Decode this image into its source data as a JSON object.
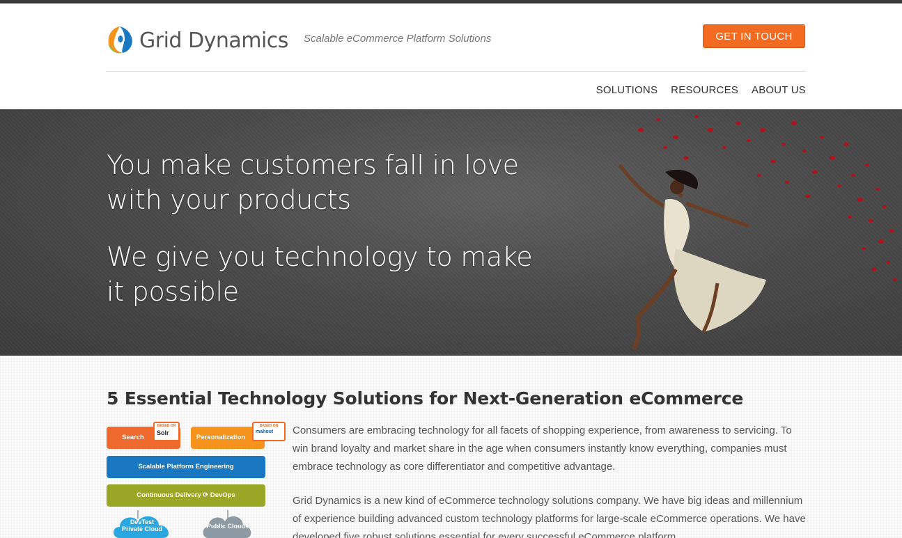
{
  "brand": {
    "name": "Grid Dynamics",
    "tagline": "Scalable eCommerce Platform Solutions",
    "cta_label": "GET IN TOUCH",
    "accent": "#f26b21"
  },
  "nav": {
    "items": [
      {
        "label": "SOLUTIONS"
      },
      {
        "label": "RESOURCES"
      },
      {
        "label": "ABOUT US"
      }
    ]
  },
  "hero": {
    "line1": "You make customers fall in love with your products",
    "line2": "We give you technology to make it possible"
  },
  "section": {
    "title": "5 Essential Technology Solutions for Next-Generation eCommerce",
    "paragraph1": "Consumers are embracing technology for all facets of shopping experience, from awareness to servicing. To win brand loyalty and market share in the age when consumers instantly know everything, companies must embrace technology as core differentiator and competitive advantage.",
    "paragraph2": "Grid Dynamics is a new kind of eCommerce technology solutions company. We have big ideas and millennium of experience building advanced custom technology platforms for large-scale eCommerce operations. We have developed five robust solutions essential for every successful eCommerce platform."
  },
  "diagram": {
    "search": "Search",
    "personalization": "Personalization",
    "scalable": "Scalable Platform Engineering",
    "continuous": "Continuous Delivery",
    "devops": "DevOps",
    "devtest_line1": "DevTest",
    "devtest_line2": "Private Cloud",
    "public_clouds": "Public Clouds",
    "based_on": "BASED ON",
    "solr": "Solr",
    "mahout": "mahout",
    "colors": {
      "search": "#ee6a2f",
      "personalization": "#f5931d",
      "scalable": "#1a78c2",
      "continuous": "#99a626",
      "devtest": "#2aa7e0",
      "public": "#8e9aa3"
    }
  }
}
